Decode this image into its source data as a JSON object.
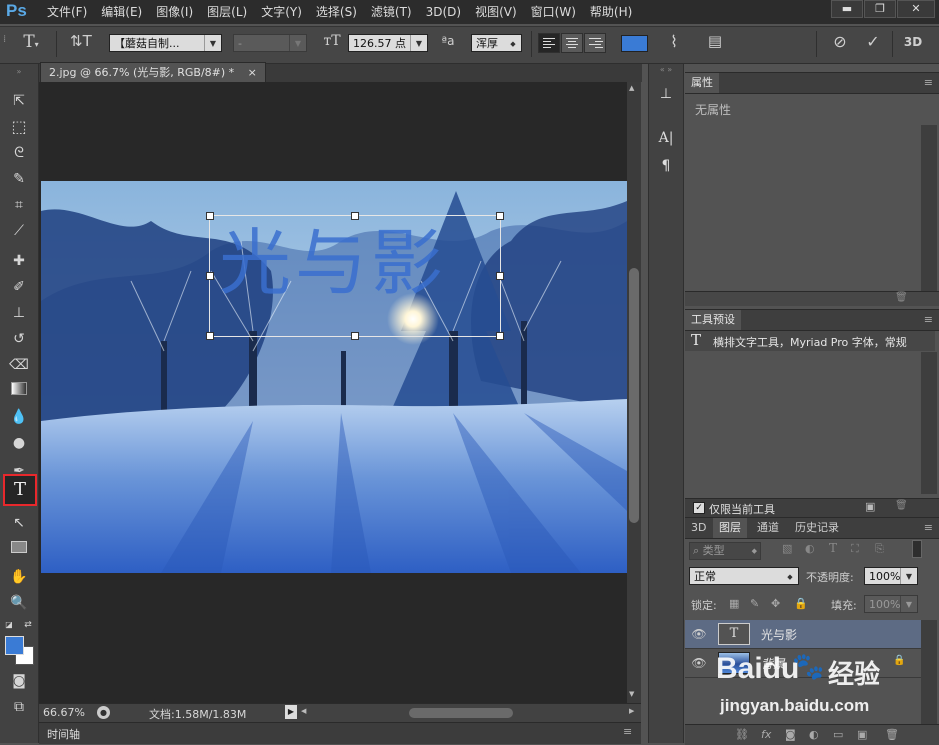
{
  "app": {
    "logo": "Ps"
  },
  "menu": [
    "文件(F)",
    "编辑(E)",
    "图像(I)",
    "图层(L)",
    "文字(Y)",
    "选择(S)",
    "滤镜(T)",
    "3D(D)",
    "视图(V)",
    "窗口(W)",
    "帮助(H)"
  ],
  "window_controls": {
    "minimize": "▬",
    "maximize": "❐",
    "close": "✕"
  },
  "options": {
    "font_family": "【蘑菇自制...",
    "font_style": "-",
    "font_size": "126.57 点",
    "aa_label": "ªa",
    "antialias": "浑厚",
    "color": "#3a7bd5",
    "label_3d": "3D"
  },
  "document": {
    "tab_title": "2.jpg @ 66.7% (光与影, RGB/8#) *",
    "close": "×",
    "text_content": "光与影",
    "text_color": "#3a6fcf"
  },
  "status": {
    "zoom": "66.67%",
    "doc_info": "文档:1.58M/1.83M",
    "timeline": "时间轴"
  },
  "panels": {
    "properties": {
      "tab": "属性",
      "content": "无属性"
    },
    "tool_presets": {
      "tab": "工具预设",
      "item": "横排文字工具，Myriad Pro 字体，常规",
      "current_only": "仅限当前工具"
    },
    "layers": {
      "tabs": [
        "3D",
        "图层",
        "通道",
        "历史记录"
      ],
      "filter": "类型",
      "blend_mode": "正常",
      "opacity_label": "不透明度:",
      "opacity": "100%",
      "lock_label": "锁定:",
      "fill_label": "填充:",
      "fill": "100%",
      "items": [
        {
          "name": "光与影",
          "type_glyph": "T"
        },
        {
          "name": "背景"
        }
      ]
    }
  },
  "watermark": {
    "brand": "Baidu",
    "brand_cn": "经验",
    "url": "jingyan.baidu.com"
  }
}
